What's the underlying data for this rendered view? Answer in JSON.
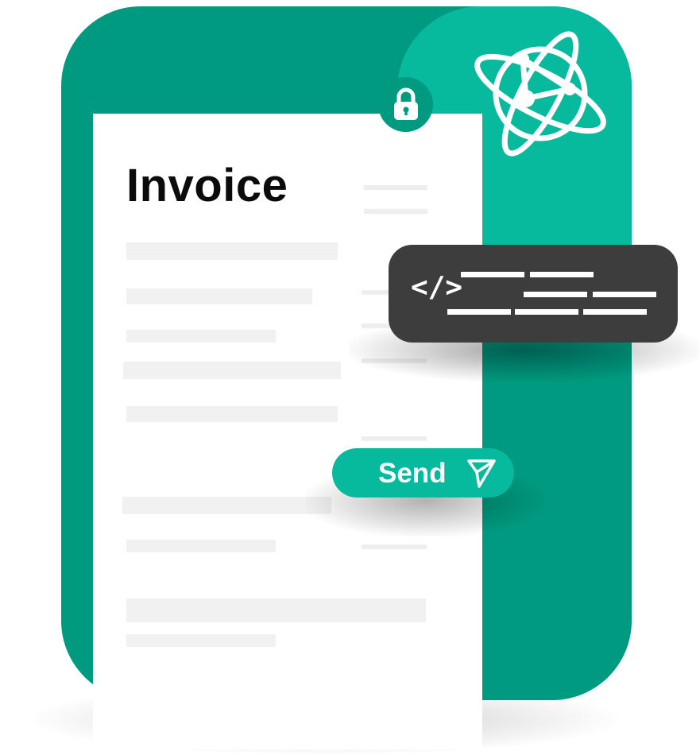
{
  "document": {
    "title": "Invoice"
  },
  "send_button": {
    "label": "Send"
  },
  "code_card": {
    "glyph": "</>"
  },
  "icons": {
    "globe": "globe-network-icon",
    "lock": "lock-icon",
    "send": "paper-plane-icon",
    "code": "code-brackets-icon"
  },
  "colors": {
    "primary_green": "#009a80",
    "light_green": "#07b99d",
    "code_card_bg": "#3d3d3d",
    "document_bg": "#ffffff"
  }
}
